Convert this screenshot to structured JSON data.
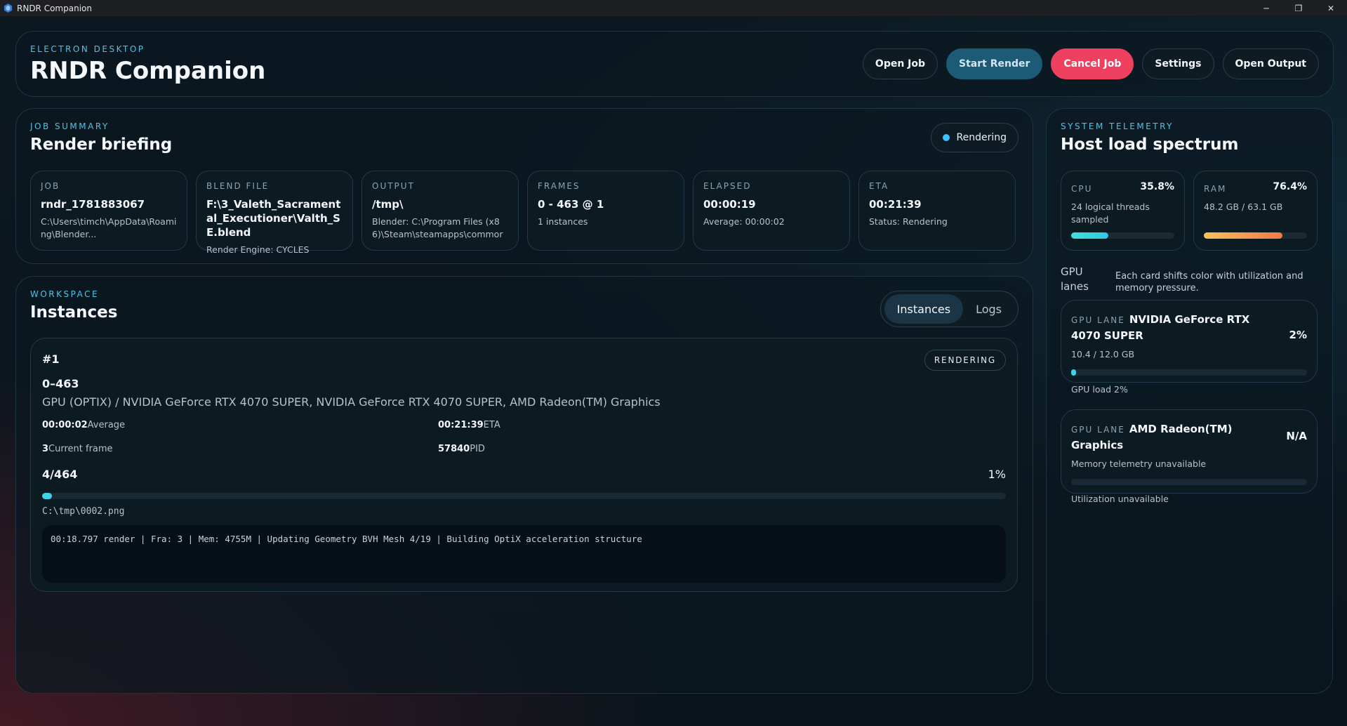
{
  "window": {
    "title": "RNDR Companion",
    "controls": {
      "minimize": "─",
      "maximize": "❐",
      "close": "✕"
    }
  },
  "header": {
    "eyebrow": "ELECTRON DESKTOP",
    "title": "RNDR Companion",
    "actions": {
      "open_job": "Open Job",
      "start_render": "Start Render",
      "cancel_job": "Cancel Job",
      "settings": "Settings",
      "open_output": "Open Output"
    }
  },
  "summary": {
    "eyebrow": "JOB SUMMARY",
    "title": "Render briefing",
    "status": "Rendering",
    "cards": [
      {
        "label": "JOB",
        "value": "rndr_1781883067",
        "sub": "C:\\Users\\timch\\AppData\\Roaming\\Blender..."
      },
      {
        "label": "BLEND FILE",
        "value": "F:\\3_Valeth_Sacramental_Executioner\\Valth_SE.blend",
        "sub": "Render Engine: CYCLES"
      },
      {
        "label": "OUTPUT",
        "value": "/tmp\\",
        "sub": "Blender: C:\\Program Files (x86)\\Steam\\steamapps\\commor"
      },
      {
        "label": "FRAMES",
        "value": "0 - 463 @ 1",
        "sub": "1 instances"
      },
      {
        "label": "ELAPSED",
        "value": "00:00:19",
        "sub": "Average: 00:00:02"
      },
      {
        "label": "ETA",
        "value": "00:21:39",
        "sub": "Status: Rendering"
      }
    ]
  },
  "workspace": {
    "eyebrow": "WORKSPACE",
    "title": "Instances",
    "tabs": {
      "instances": "Instances",
      "logs": "Logs"
    },
    "instance": {
      "id": "#1",
      "badge": "RENDERING",
      "range": "0–463",
      "gpu": "GPU (OPTIX) / NVIDIA GeForce RTX 4070 SUPER, NVIDIA GeForce RTX 4070 SUPER, AMD Radeon(TM) Graphics",
      "average_value": "00:00:02",
      "average_label": "Average",
      "eta_value": "00:21:39",
      "eta_label": "ETA",
      "frame_value": "3",
      "frame_label": "Current frame",
      "pid_value": "57840",
      "pid_label": "PID",
      "progress_count": "4/464",
      "progress_pct": "1%",
      "progress_fraction": 0.01,
      "output_path": "C:\\tmp\\0002.png",
      "log": "00:18.797 render | Fra: 3 | Mem: 4755M | Updating Geometry BVH Mesh 4/19 | Building OptiX acceleration structure"
    }
  },
  "telemetry": {
    "eyebrow": "SYSTEM TELEMETRY",
    "title": "Host load spectrum",
    "cpu": {
      "label": "CPU",
      "pct": "35.8%",
      "sub": "24 logical threads sampled",
      "fraction": 0.358,
      "color": "#3fd8e0"
    },
    "ram": {
      "label": "RAM",
      "pct": "76.4%",
      "sub": "48.2 GB / 63.1 GB",
      "fraction": 0.764,
      "color": "#f59e55"
    },
    "gpu_heading": "GPU lanes",
    "gpu_desc": "Each card shifts color with utilization and memory pressure.",
    "lanes": [
      {
        "label": "GPU LANE",
        "name": "NVIDIA GeForce RTX 4070 SUPER",
        "pct": "2%",
        "sub": "10.4 / 12.0 GB",
        "fraction": 0.02,
        "foot": "GPU load 2%"
      },
      {
        "label": "GPU LANE",
        "name": "AMD Radeon(TM) Graphics",
        "pct": "N/A",
        "sub": "Memory telemetry unavailable",
        "fraction": 0,
        "foot": "Utilization unavailable"
      }
    ]
  }
}
